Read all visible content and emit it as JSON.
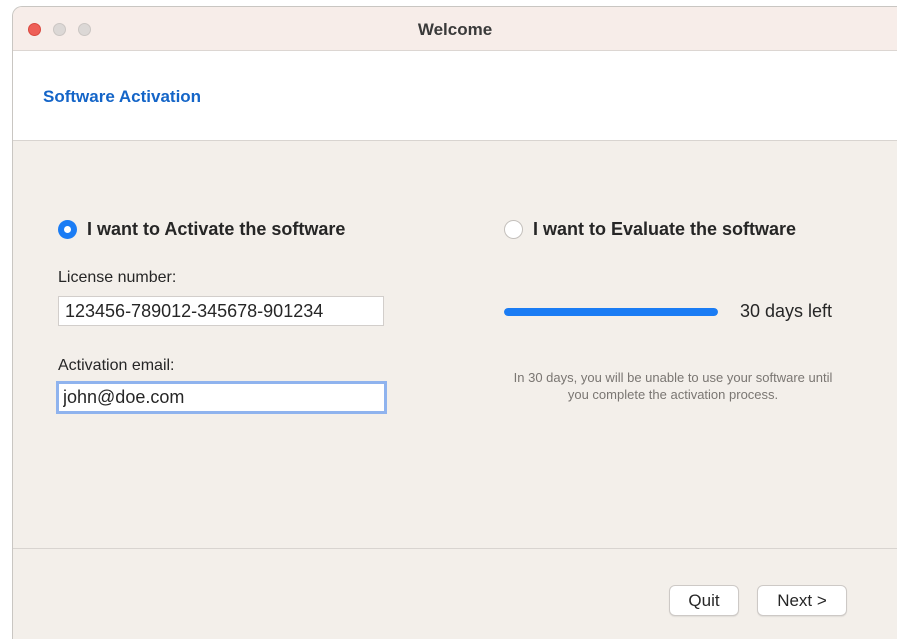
{
  "window": {
    "title": "Welcome"
  },
  "header": {
    "title": "Software Activation"
  },
  "activate": {
    "option_label": "I want to Activate the software",
    "selected": true,
    "license_label": "License number:",
    "license_value": "123456-789012-345678-901234",
    "email_label": "Activation email:",
    "email_value": "john@doe.com"
  },
  "evaluate": {
    "option_label": "I want to Evaluate the software",
    "selected": false,
    "progress_fraction": 1.0,
    "days_left_text": "30 days left",
    "note": "In 30 days, you will be unable to use your software until you complete the activation process."
  },
  "buttons": {
    "quit": "Quit",
    "next": "Next >"
  },
  "colors": {
    "accent": "#1a7cf4",
    "header_title": "#1465c8",
    "close": "#ee5f57"
  }
}
